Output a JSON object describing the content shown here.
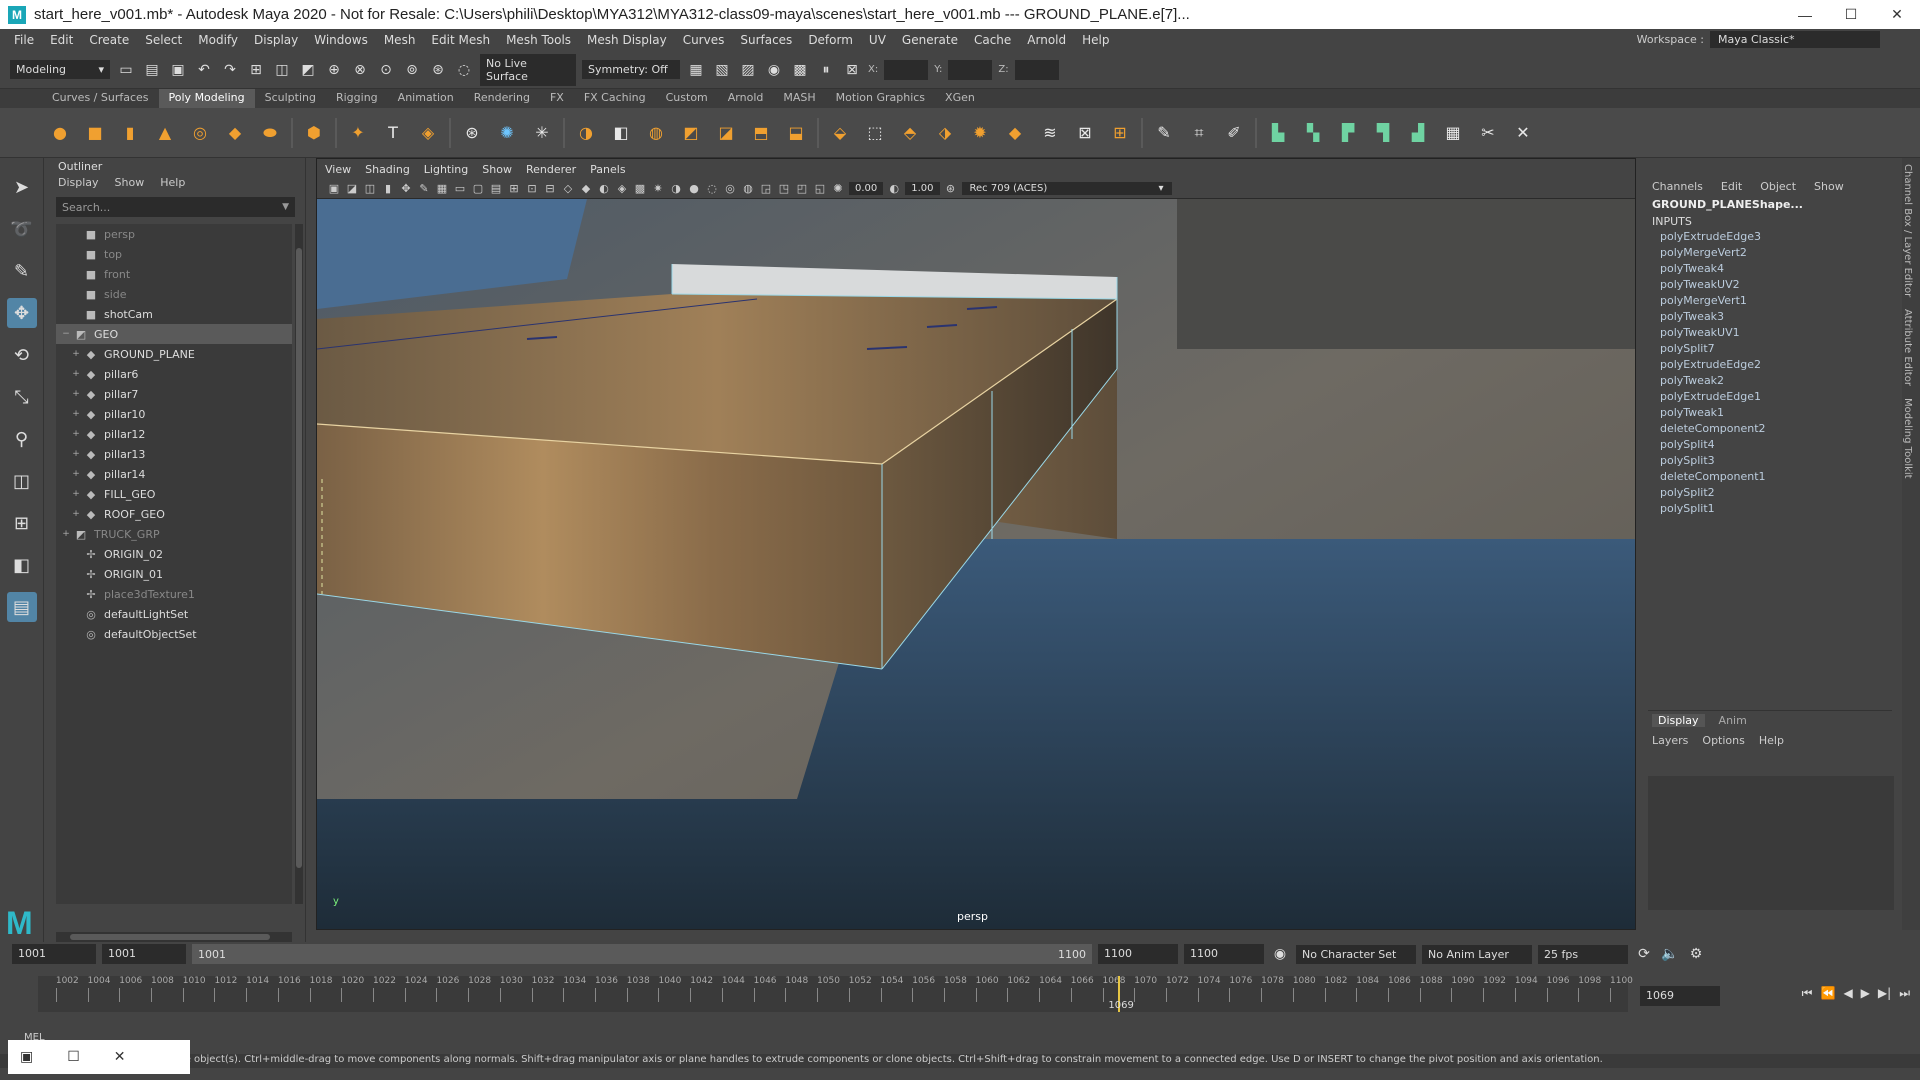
{
  "window": {
    "title": "start_here_v001.mb* - Autodesk Maya 2020 - Not for Resale: C:\\Users\\phili\\Desktop\\MYA312\\MYA312-class09-maya\\scenes\\start_here_v001.mb    ---   GROUND_PLANE.e[7]...",
    "icon": "M",
    "minimize": "—",
    "maximize": "☐",
    "close": "✕"
  },
  "menubar": {
    "items": [
      "File",
      "Edit",
      "Create",
      "Select",
      "Modify",
      "Display",
      "Windows",
      "Mesh",
      "Edit Mesh",
      "Mesh Tools",
      "Mesh Display",
      "Curves",
      "Surfaces",
      "Deform",
      "UV",
      "Generate",
      "Cache",
      "Arnold",
      "Help"
    ],
    "workspace_label": "Workspace :",
    "workspace_value": "Maya Classic*"
  },
  "statusline": {
    "mode": "Modeling",
    "live_surface": "No Live Surface",
    "symmetry": "Symmetry: Off",
    "x_label": "X:",
    "y_label": "Y:",
    "z_label": "Z:"
  },
  "shelf": {
    "tabs": [
      "Curves / Surfaces",
      "Poly Modeling",
      "Sculpting",
      "Rigging",
      "Animation",
      "Rendering",
      "FX",
      "FX Caching",
      "Custom",
      "Arnold",
      "MASH",
      "Motion Graphics",
      "XGen"
    ],
    "active_tab": "Poly Modeling"
  },
  "outliner": {
    "title": "Outliner",
    "menu": [
      "Display",
      "Show",
      "Help"
    ],
    "search_placeholder": "Search...",
    "items": [
      {
        "label": "persp",
        "icon": "camera-icon",
        "dim": true,
        "indent": 1,
        "expander": ""
      },
      {
        "label": "top",
        "icon": "camera-icon",
        "dim": true,
        "indent": 1,
        "expander": ""
      },
      {
        "label": "front",
        "icon": "camera-icon",
        "dim": true,
        "indent": 1,
        "expander": ""
      },
      {
        "label": "side",
        "icon": "camera-icon",
        "dim": true,
        "indent": 1,
        "expander": ""
      },
      {
        "label": "shotCam",
        "icon": "camera-icon",
        "dim": false,
        "indent": 1,
        "expander": ""
      },
      {
        "label": "GEO",
        "icon": "group-icon",
        "dim": false,
        "indent": 0,
        "expander": "−",
        "selected": true
      },
      {
        "label": "GROUND_PLANE",
        "icon": "mesh-icon",
        "dim": false,
        "indent": 1,
        "expander": "+"
      },
      {
        "label": "pillar6",
        "icon": "mesh-icon",
        "dim": false,
        "indent": 1,
        "expander": "+"
      },
      {
        "label": "pillar7",
        "icon": "mesh-icon",
        "dim": false,
        "indent": 1,
        "expander": "+"
      },
      {
        "label": "pillar10",
        "icon": "mesh-icon",
        "dim": false,
        "indent": 1,
        "expander": "+"
      },
      {
        "label": "pillar12",
        "icon": "mesh-icon",
        "dim": false,
        "indent": 1,
        "expander": "+"
      },
      {
        "label": "pillar13",
        "icon": "mesh-icon",
        "dim": false,
        "indent": 1,
        "expander": "+"
      },
      {
        "label": "pillar14",
        "icon": "mesh-icon",
        "dim": false,
        "indent": 1,
        "expander": "+"
      },
      {
        "label": "FILL_GEO",
        "icon": "mesh-icon",
        "dim": false,
        "indent": 1,
        "expander": "+"
      },
      {
        "label": "ROOF_GEO",
        "icon": "mesh-icon",
        "dim": false,
        "indent": 1,
        "expander": "+"
      },
      {
        "label": "TRUCK_GRP",
        "icon": "group-icon",
        "dim": true,
        "indent": 0,
        "expander": "+"
      },
      {
        "label": "ORIGIN_02",
        "icon": "locator-icon",
        "dim": false,
        "indent": 1,
        "expander": ""
      },
      {
        "label": "ORIGIN_01",
        "icon": "locator-icon",
        "dim": false,
        "indent": 1,
        "expander": ""
      },
      {
        "label": "place3dTexture1",
        "icon": "locator-icon",
        "dim": true,
        "indent": 1,
        "expander": ""
      },
      {
        "label": "defaultLightSet",
        "icon": "set-icon",
        "dim": false,
        "indent": 1,
        "expander": ""
      },
      {
        "label": "defaultObjectSet",
        "icon": "set-icon",
        "dim": false,
        "indent": 1,
        "expander": ""
      }
    ]
  },
  "viewport": {
    "menu": [
      "View",
      "Shading",
      "Lighting",
      "Show",
      "Renderer",
      "Panels"
    ],
    "field_a": "0.00",
    "field_b": "1.00",
    "colorspace": "Rec 709 (ACES)",
    "camera": "persp",
    "axis_label": "y"
  },
  "channelbox": {
    "menu": [
      "Channels",
      "Edit",
      "Object",
      "Show"
    ],
    "object": "GROUND_PLANEShape...",
    "inputs_header": "INPUTS",
    "inputs": [
      "polyExtrudeEdge3",
      "polyMergeVert2",
      "polyTweak4",
      "polyTweakUV2",
      "polyMergeVert1",
      "polyTweak3",
      "polyTweakUV1",
      "polySplit7",
      "polyExtrudeEdge2",
      "polyTweak2",
      "polyExtrudeEdge1",
      "polyTweak1",
      "deleteComponent2",
      "polySplit4",
      "polySplit3",
      "deleteComponent1",
      "polySplit2",
      "polySplit1"
    ],
    "layer_tabs": [
      "Display",
      "Anim"
    ],
    "layer_menu": [
      "Layers",
      "Options",
      "Help"
    ],
    "side_tabs": [
      "Channel Box / Layer Editor",
      "Attribute Editor",
      "Modeling Toolkit"
    ]
  },
  "range": {
    "start": "1001",
    "anim_start": "1001",
    "slider_start": "1001",
    "slider_end": "1100",
    "anim_end": "1100",
    "end": "1100",
    "character_set": "No Character Set",
    "anim_layer": "No Anim Layer",
    "fps": "25 fps"
  },
  "timeline": {
    "ticks": [
      "1002",
      "1004",
      "1006",
      "1008",
      "1010",
      "1012",
      "1014",
      "1016",
      "1018",
      "1020",
      "1022",
      "1024",
      "1026",
      "1028",
      "1030",
      "1032",
      "1034",
      "1036",
      "1038",
      "1040",
      "1042",
      "1044",
      "1046",
      "1048",
      "1050",
      "1052",
      "1054",
      "1056",
      "1058",
      "1060",
      "1062",
      "1064",
      "1066",
      "1068",
      "1070",
      "1072",
      "1074",
      "1076",
      "1078",
      "1080",
      "1082",
      "1084",
      "1086",
      "1088",
      "1090",
      "1092",
      "1094",
      "1096",
      "1098",
      "1100"
    ],
    "current": "1069",
    "current_frame": 1069,
    "first": 1001,
    "last": 1100,
    "current_field": "1069"
  },
  "cmdline": {
    "mel": "MEL",
    "help": "Move Tool: Use manipulator to move object(s). Ctrl+middle-drag to move components along normals. Shift+drag manipulator axis or plane handles to extrude components or clone objects. Ctrl+Shift+drag to constrain movement to a connected edge. Use D or INSERT to change the pivot position and axis orientation."
  },
  "colors": {
    "accent": "#5285a6",
    "maya_teal": "#2fb9c9",
    "timeline_cursor": "#e5c544"
  }
}
